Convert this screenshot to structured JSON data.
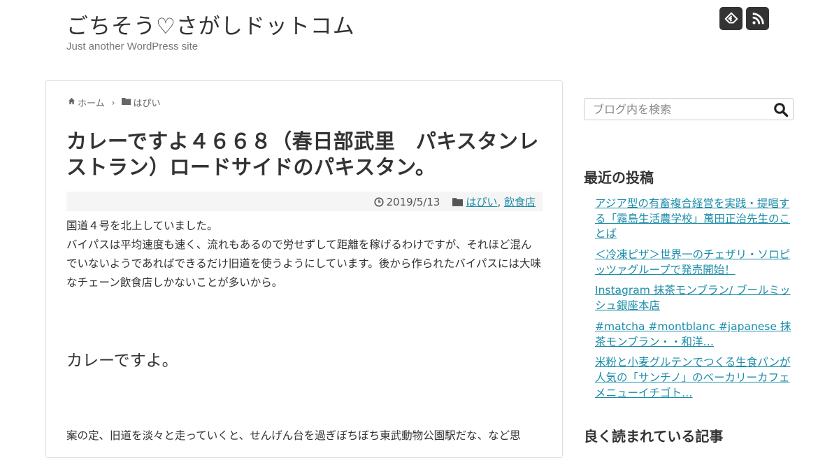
{
  "header": {
    "site_title": "ごちそう♡さがしドットコム",
    "site_description": "Just another WordPress site",
    "social_icons": [
      "feedly-icon",
      "rss-icon"
    ]
  },
  "breadcrumb": {
    "home": "ホーム",
    "category": "はぴい"
  },
  "article": {
    "title": "カレーですよ４６６８（春日部武里　パキスタンレストラン）ロードサイドのパキスタン。",
    "date": "2019/5/13",
    "categories": [
      "はぴい",
      "飲食店"
    ],
    "paragraph1": [
      "国道４号を北上していました。",
      "バイパスは平均速度も速く、流れもあるので労せずして距離を稼げるわけですが、それほど混んでいないようであればできるだけ旧道を使うようにしています。後から作られたバイパスには大味なチェーン飲食店しかないことが多いから。"
    ],
    "subheading": "カレーですよ。",
    "paragraph2": "案の定、旧道を淡々と走っていくと、せんげん台を過ぎぼちぼち東武動物公園駅だな、など思"
  },
  "sidebar": {
    "search_placeholder": "ブログ内を検索",
    "recent_title": "最近の投稿",
    "recent_posts": [
      "アジア型の有畜複合経営を実践・提唱する「霧島生活農学校」萬田正治先生のことば",
      "＜冷凍ピザ＞世界一のチェザリ・ソロピッツァグループで発売開始！",
      "Instagram 抹茶モンブラン/ ブールミッシュ銀座本店",
      "#matcha #montblanc #japanese 抹茶モンブラン・・和洋…",
      "米粉と小麦グルテンでつくる生食パンが人気の「サンチノ」のベーカリーカフェメニューイチゴト…"
    ],
    "popular_title": "良く読まれている記事"
  },
  "colors": {
    "link": "#1a8ca8",
    "text": "#333333",
    "icon_bg": "#333333"
  }
}
